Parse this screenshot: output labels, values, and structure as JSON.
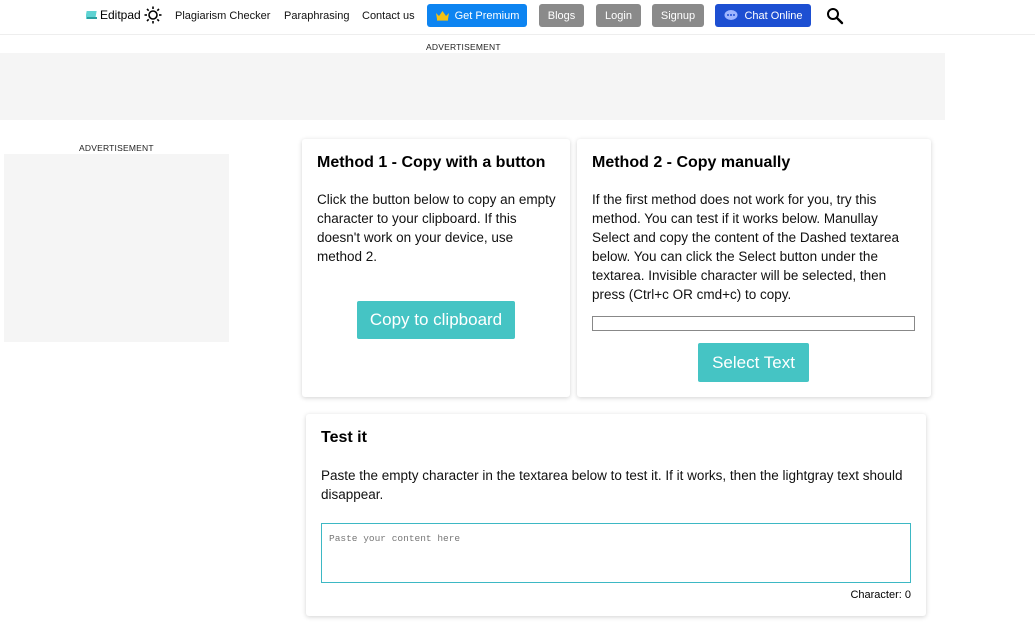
{
  "header": {
    "logo": "Editpad",
    "nav": [
      "Plagiarism Checker",
      "Paraphrasing",
      "Contact us"
    ],
    "premium": "Get Premium",
    "blogs": "Blogs",
    "login": "Login",
    "signup": "Signup",
    "chat": "Chat Online"
  },
  "ads": {
    "top_label": "ADVERTISEMENT",
    "side_label": "ADVERTISEMENT"
  },
  "method1": {
    "title": "Method 1 - Copy with a button",
    "text": "Click the button below to copy an empty character to your clipboard. If this doesn't work on your device, use method 2.",
    "button": "Copy to clipboard"
  },
  "method2": {
    "title": "Method 2 - Copy manually",
    "text": "If the first method does not work for you, try this method. You can test if it works below. Manullay Select and copy the content of the Dashed textarea below. You can click the Select button under the textarea. Invisible character will be selected, then press (Ctrl+c OR cmd+c) to copy.",
    "button": "Select Text"
  },
  "test": {
    "title": "Test it",
    "text": "Paste the empty character in the textarea below to test it. If it works, then the lightgray text should disappear.",
    "placeholder": "Paste your content here",
    "counter": "Character: 0"
  },
  "colors": {
    "teal": "#45c4c4",
    "premium_blue": "#0d84f1",
    "chat_blue": "#1d4fd2",
    "gray_button": "#8a8a8a"
  }
}
